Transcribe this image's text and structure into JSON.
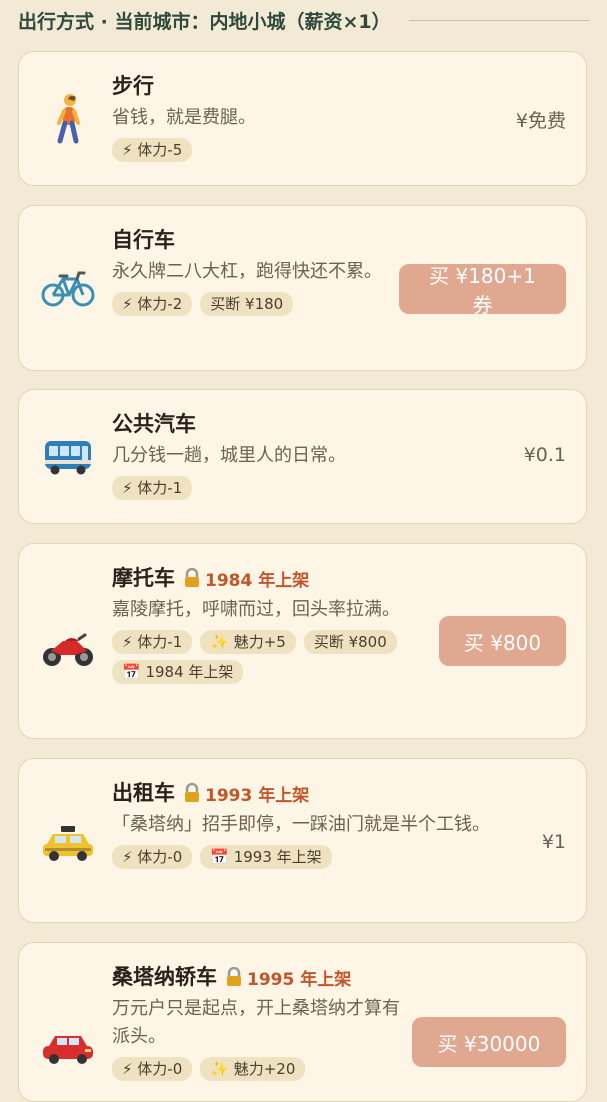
{
  "header": {
    "title": "出行方式 · 当前城市：内地小城（薪资×1）"
  },
  "cards": [
    {
      "title": "步行",
      "desc": "省钱，就是费腿。",
      "tags": [
        "⚡ 体力-5"
      ],
      "price": "¥免费",
      "icon": "walking-person-icon"
    },
    {
      "title": "自行车",
      "desc": "永久牌二八大杠，跑得快还不累。",
      "tags": [
        "⚡ 体力-2",
        "买断 ¥180"
      ],
      "button": "买 ¥180+1券",
      "icon": "bicycle-icon"
    },
    {
      "title": "公共汽车",
      "desc": "几分钱一趟，城里人的日常。",
      "tags": [
        "⚡ 体力-1"
      ],
      "price": "¥0.1",
      "icon": "bus-icon"
    },
    {
      "title": "摩托车",
      "lock": "🔒",
      "unlock": "1984 年上架",
      "desc": "嘉陵摩托，呼啸而过，回头率拉满。",
      "tags": [
        "⚡ 体力-1",
        "✨ 魅力+5",
        "买断 ¥800",
        "📅 1984 年上架"
      ],
      "button": "买 ¥800",
      "icon": "motorcycle-icon"
    },
    {
      "title": "出租车",
      "lock": "🔒",
      "unlock": "1993 年上架",
      "desc": "「桑塔纳」招手即停，一踩油门就是半个工钱。",
      "tags": [
        "⚡ 体力-0",
        "📅 1993 年上架"
      ],
      "price": "¥1",
      "icon": "taxi-icon"
    },
    {
      "title": "桑塔纳轿车",
      "lock": "🔒",
      "unlock": "1995 年上架",
      "desc": "万元户只是起点，开上桑塔纳才算有派头。",
      "tags": [
        "⚡ 体力-0",
        "✨ 魅力+20"
      ],
      "button": "买 ¥30000",
      "icon": "car-icon"
    }
  ],
  "colors": {
    "background": "#f3ead6",
    "card": "#fdf6e6",
    "accent_button": "#e0a891",
    "unlock_text": "#c4552b",
    "header_text": "#2f4a3c"
  }
}
